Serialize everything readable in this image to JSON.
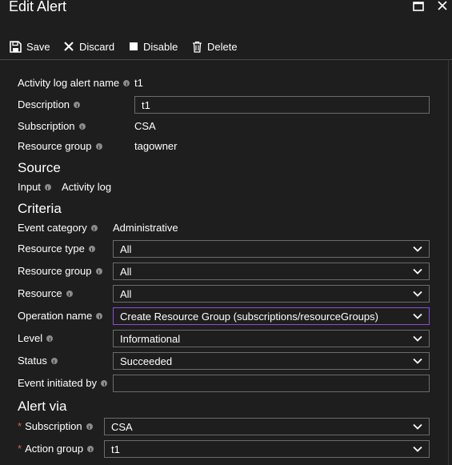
{
  "window": {
    "title": "Edit Alert"
  },
  "toolbar": {
    "save": "Save",
    "discard": "Discard",
    "disable": "Disable",
    "delete": "Delete"
  },
  "details": {
    "alert_name_label": "Activity log alert name",
    "alert_name_value": "t1",
    "description_label": "Description",
    "description_value": "t1",
    "subscription_label": "Subscription",
    "subscription_value": "CSA",
    "resource_group_label": "Resource group",
    "resource_group_value": "tagowner"
  },
  "source": {
    "heading": "Source",
    "input_label": "Input",
    "input_value": "Activity log"
  },
  "criteria": {
    "heading": "Criteria",
    "event_category_label": "Event category",
    "event_category_value": "Administrative",
    "resource_type_label": "Resource type",
    "resource_type_value": "All",
    "resource_group_label": "Resource group",
    "resource_group_value": "All",
    "resource_label": "Resource",
    "resource_value": "All",
    "operation_name_label": "Operation name",
    "operation_name_value": "Create Resource Group (subscriptions/resourceGroups)",
    "level_label": "Level",
    "level_value": "Informational",
    "status_label": "Status",
    "status_value": "Succeeded",
    "event_initiated_label": "Event initiated by",
    "event_initiated_value": ""
  },
  "alert_via": {
    "heading": "Alert via",
    "subscription_label": "Subscription",
    "subscription_value": "CSA",
    "action_group_label": "Action group",
    "action_group_value": "t1"
  },
  "colors": {
    "background": "#1e1e1e",
    "border": "#6b6b6b",
    "focus_border": "#8a4fd1",
    "required": "#e05a5a"
  }
}
